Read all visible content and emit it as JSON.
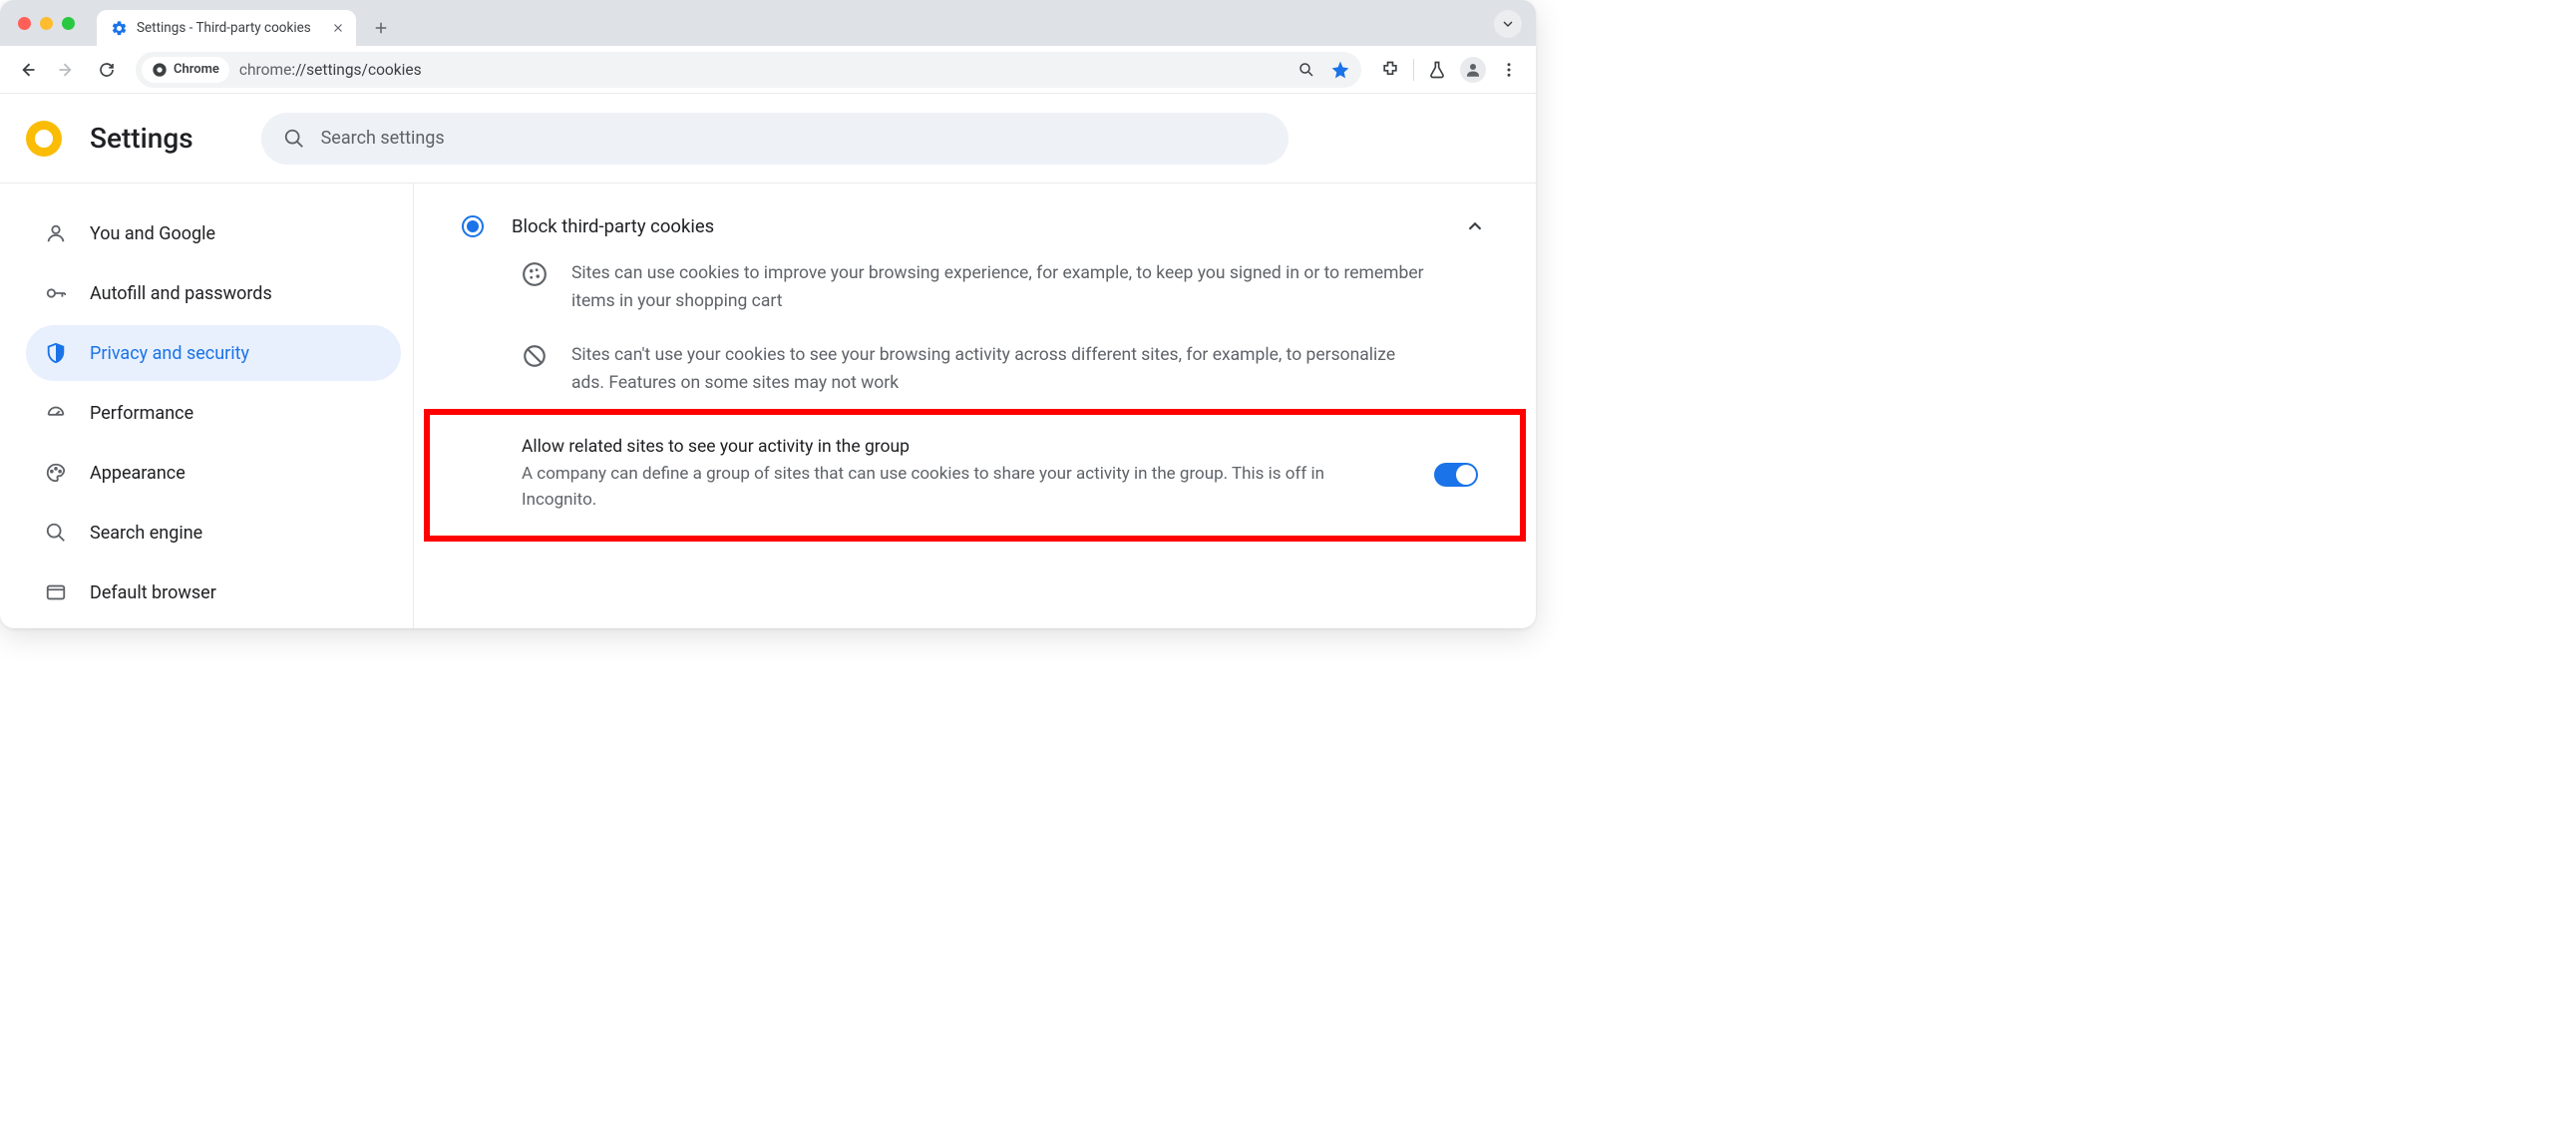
{
  "window": {
    "tab_title": "Settings - Third-party cookies",
    "url_scheme": "chrome",
    "url_path": "://settings/cookies",
    "chrome_chip": "Chrome"
  },
  "header": {
    "title": "Settings",
    "search_placeholder": "Search settings"
  },
  "sidebar": {
    "items": [
      {
        "label": "You and Google",
        "icon": "person"
      },
      {
        "label": "Autofill and passwords",
        "icon": "key"
      },
      {
        "label": "Privacy and security",
        "icon": "shield",
        "active": true
      },
      {
        "label": "Performance",
        "icon": "speed"
      },
      {
        "label": "Appearance",
        "icon": "palette"
      },
      {
        "label": "Search engine",
        "icon": "search"
      },
      {
        "label": "Default browser",
        "icon": "browser"
      }
    ]
  },
  "main": {
    "option_title": "Block third-party cookies",
    "detail1": "Sites can use cookies to improve your browsing experience, for example, to keep you signed in or to remember items in your shopping cart",
    "detail2": "Sites can't use your cookies to see your browsing activity across different sites, for example, to personalize ads. Features on some sites may not work",
    "toggle_title": "Allow related sites to see your activity in the group",
    "toggle_sub": "A company can define a group of sites that can use cookies to share your activity in the group. This is off in Incognito.",
    "toggle_on": true
  }
}
